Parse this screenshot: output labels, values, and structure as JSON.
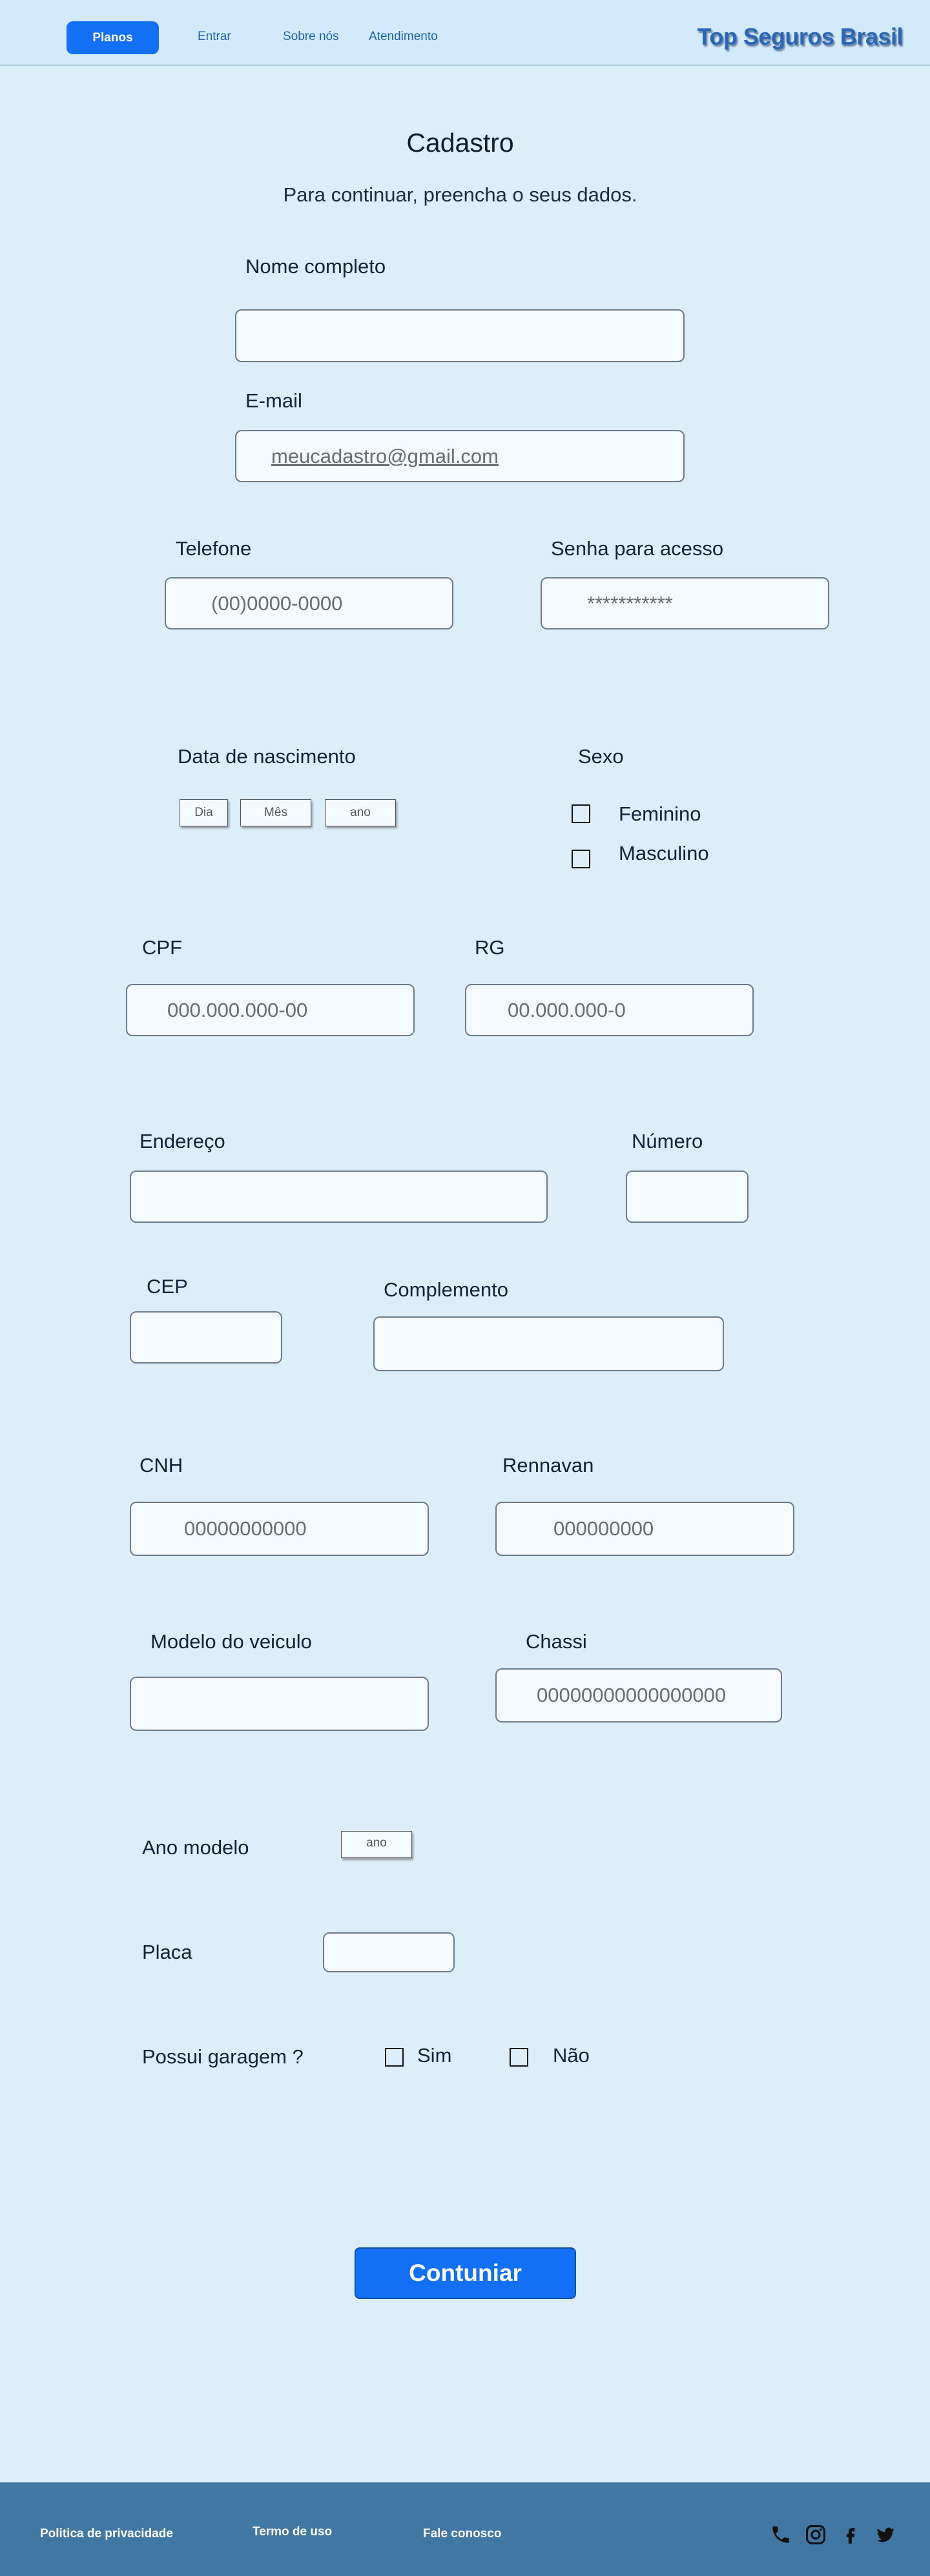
{
  "header": {
    "nav": {
      "planos": "Planos",
      "entrar": "Entrar",
      "sobre": "Sobre nós",
      "atendimento": "Atendimento"
    },
    "brand": "Top Seguros Brasil"
  },
  "page": {
    "title": "Cadastro",
    "subtitle": "Para continuar, preencha o seus dados."
  },
  "form": {
    "nome": {
      "label": "Nome completo",
      "value": ""
    },
    "email": {
      "label": "E-mail",
      "value": "meucadastro@gmail.com"
    },
    "telefone": {
      "label": "Telefone",
      "placeholder": "(00)0000-0000"
    },
    "senha": {
      "label": "Senha para acesso",
      "placeholder": "***********"
    },
    "nascimento": {
      "label": "Data de nascimento",
      "dia": "Dia",
      "mes": "Mês",
      "ano": "ano"
    },
    "sexo": {
      "label": "Sexo",
      "feminino": "Feminino",
      "masculino": "Masculino"
    },
    "cpf": {
      "label": "CPF",
      "placeholder": "000.000.000-00"
    },
    "rg": {
      "label": "RG",
      "placeholder": "00.000.000-0"
    },
    "endereco": {
      "label": "Endereço",
      "value": ""
    },
    "numero": {
      "label": "Número",
      "value": ""
    },
    "cep": {
      "label": "CEP",
      "value": ""
    },
    "complemento": {
      "label": "Complemento",
      "value": ""
    },
    "cnh": {
      "label": "CNH",
      "placeholder": "00000000000"
    },
    "renavan": {
      "label": "Rennavan",
      "placeholder": "000000000"
    },
    "modelo": {
      "label": "Modelo do veiculo",
      "value": ""
    },
    "chassi": {
      "label": "Chassi",
      "placeholder": "00000000000000000"
    },
    "ano_modelo": {
      "label": "Ano modelo",
      "placeholder": "ano"
    },
    "placa": {
      "label": "Placa",
      "value": ""
    },
    "garagem": {
      "label": "Possui garagem ?",
      "sim": "Sim",
      "nao": "Não"
    },
    "submit": "Contuniar"
  },
  "footer": {
    "privacidade": "Politica de privacidade",
    "termo": "Termo de uso",
    "fale": "Fale conosco",
    "icons": [
      "phone-icon",
      "instagram-icon",
      "facebook-icon",
      "twitter-icon"
    ]
  },
  "colors": {
    "accent": "#1170f5",
    "background": "#dbeef9",
    "header": "#d3eafc",
    "footer": "#4178a3"
  }
}
